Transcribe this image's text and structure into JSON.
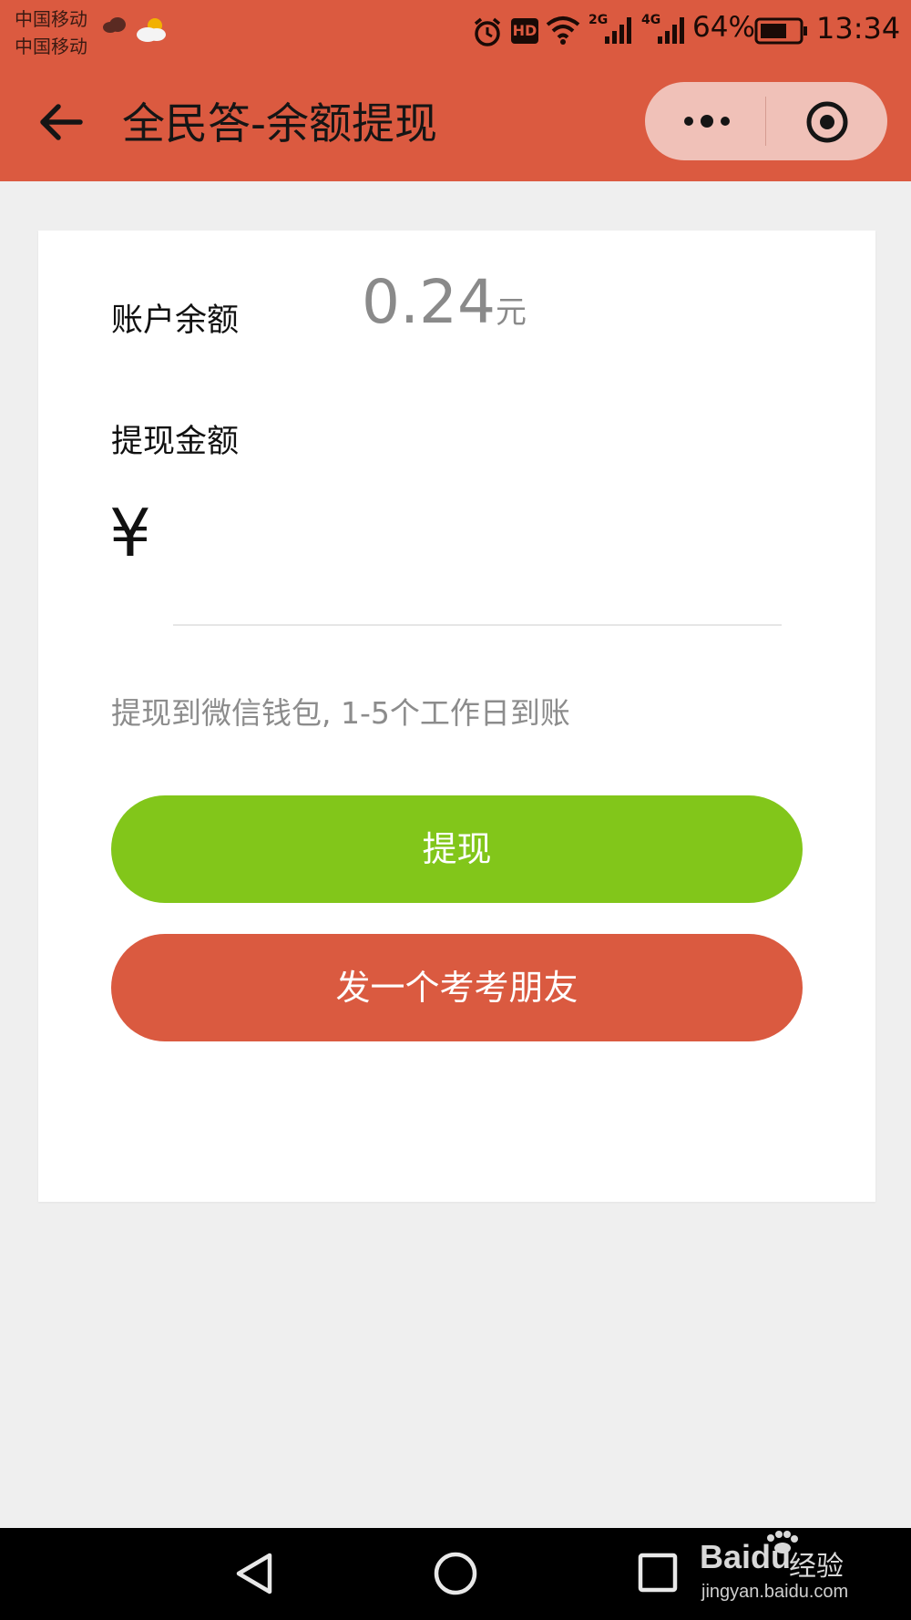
{
  "status_bar": {
    "carrier_1": "中国移动",
    "carrier_2": "中国移动",
    "network_1": "2G",
    "network_2": "4G",
    "battery": "64%",
    "time": "13:34",
    "hd_label": "HD"
  },
  "nav": {
    "title": "全民答-余额提现"
  },
  "account": {
    "balance_label": "账户余额",
    "balance_value": "0.24",
    "balance_unit": "元",
    "withdraw_label": "提现金额",
    "currency_symbol": "¥",
    "amount_value": "",
    "hint": "提现到微信钱包, 1-5个工作日到账"
  },
  "buttons": {
    "withdraw": "提现",
    "share": "发一个考考朋友"
  },
  "watermark": {
    "brand": "Bai",
    "brand_suffix": "du",
    "product": "经验",
    "url": "jingyan.baidu.com"
  },
  "colors": {
    "header": "#db5a40",
    "withdraw_button": "#82c61a",
    "share_button": "#da5a40"
  }
}
